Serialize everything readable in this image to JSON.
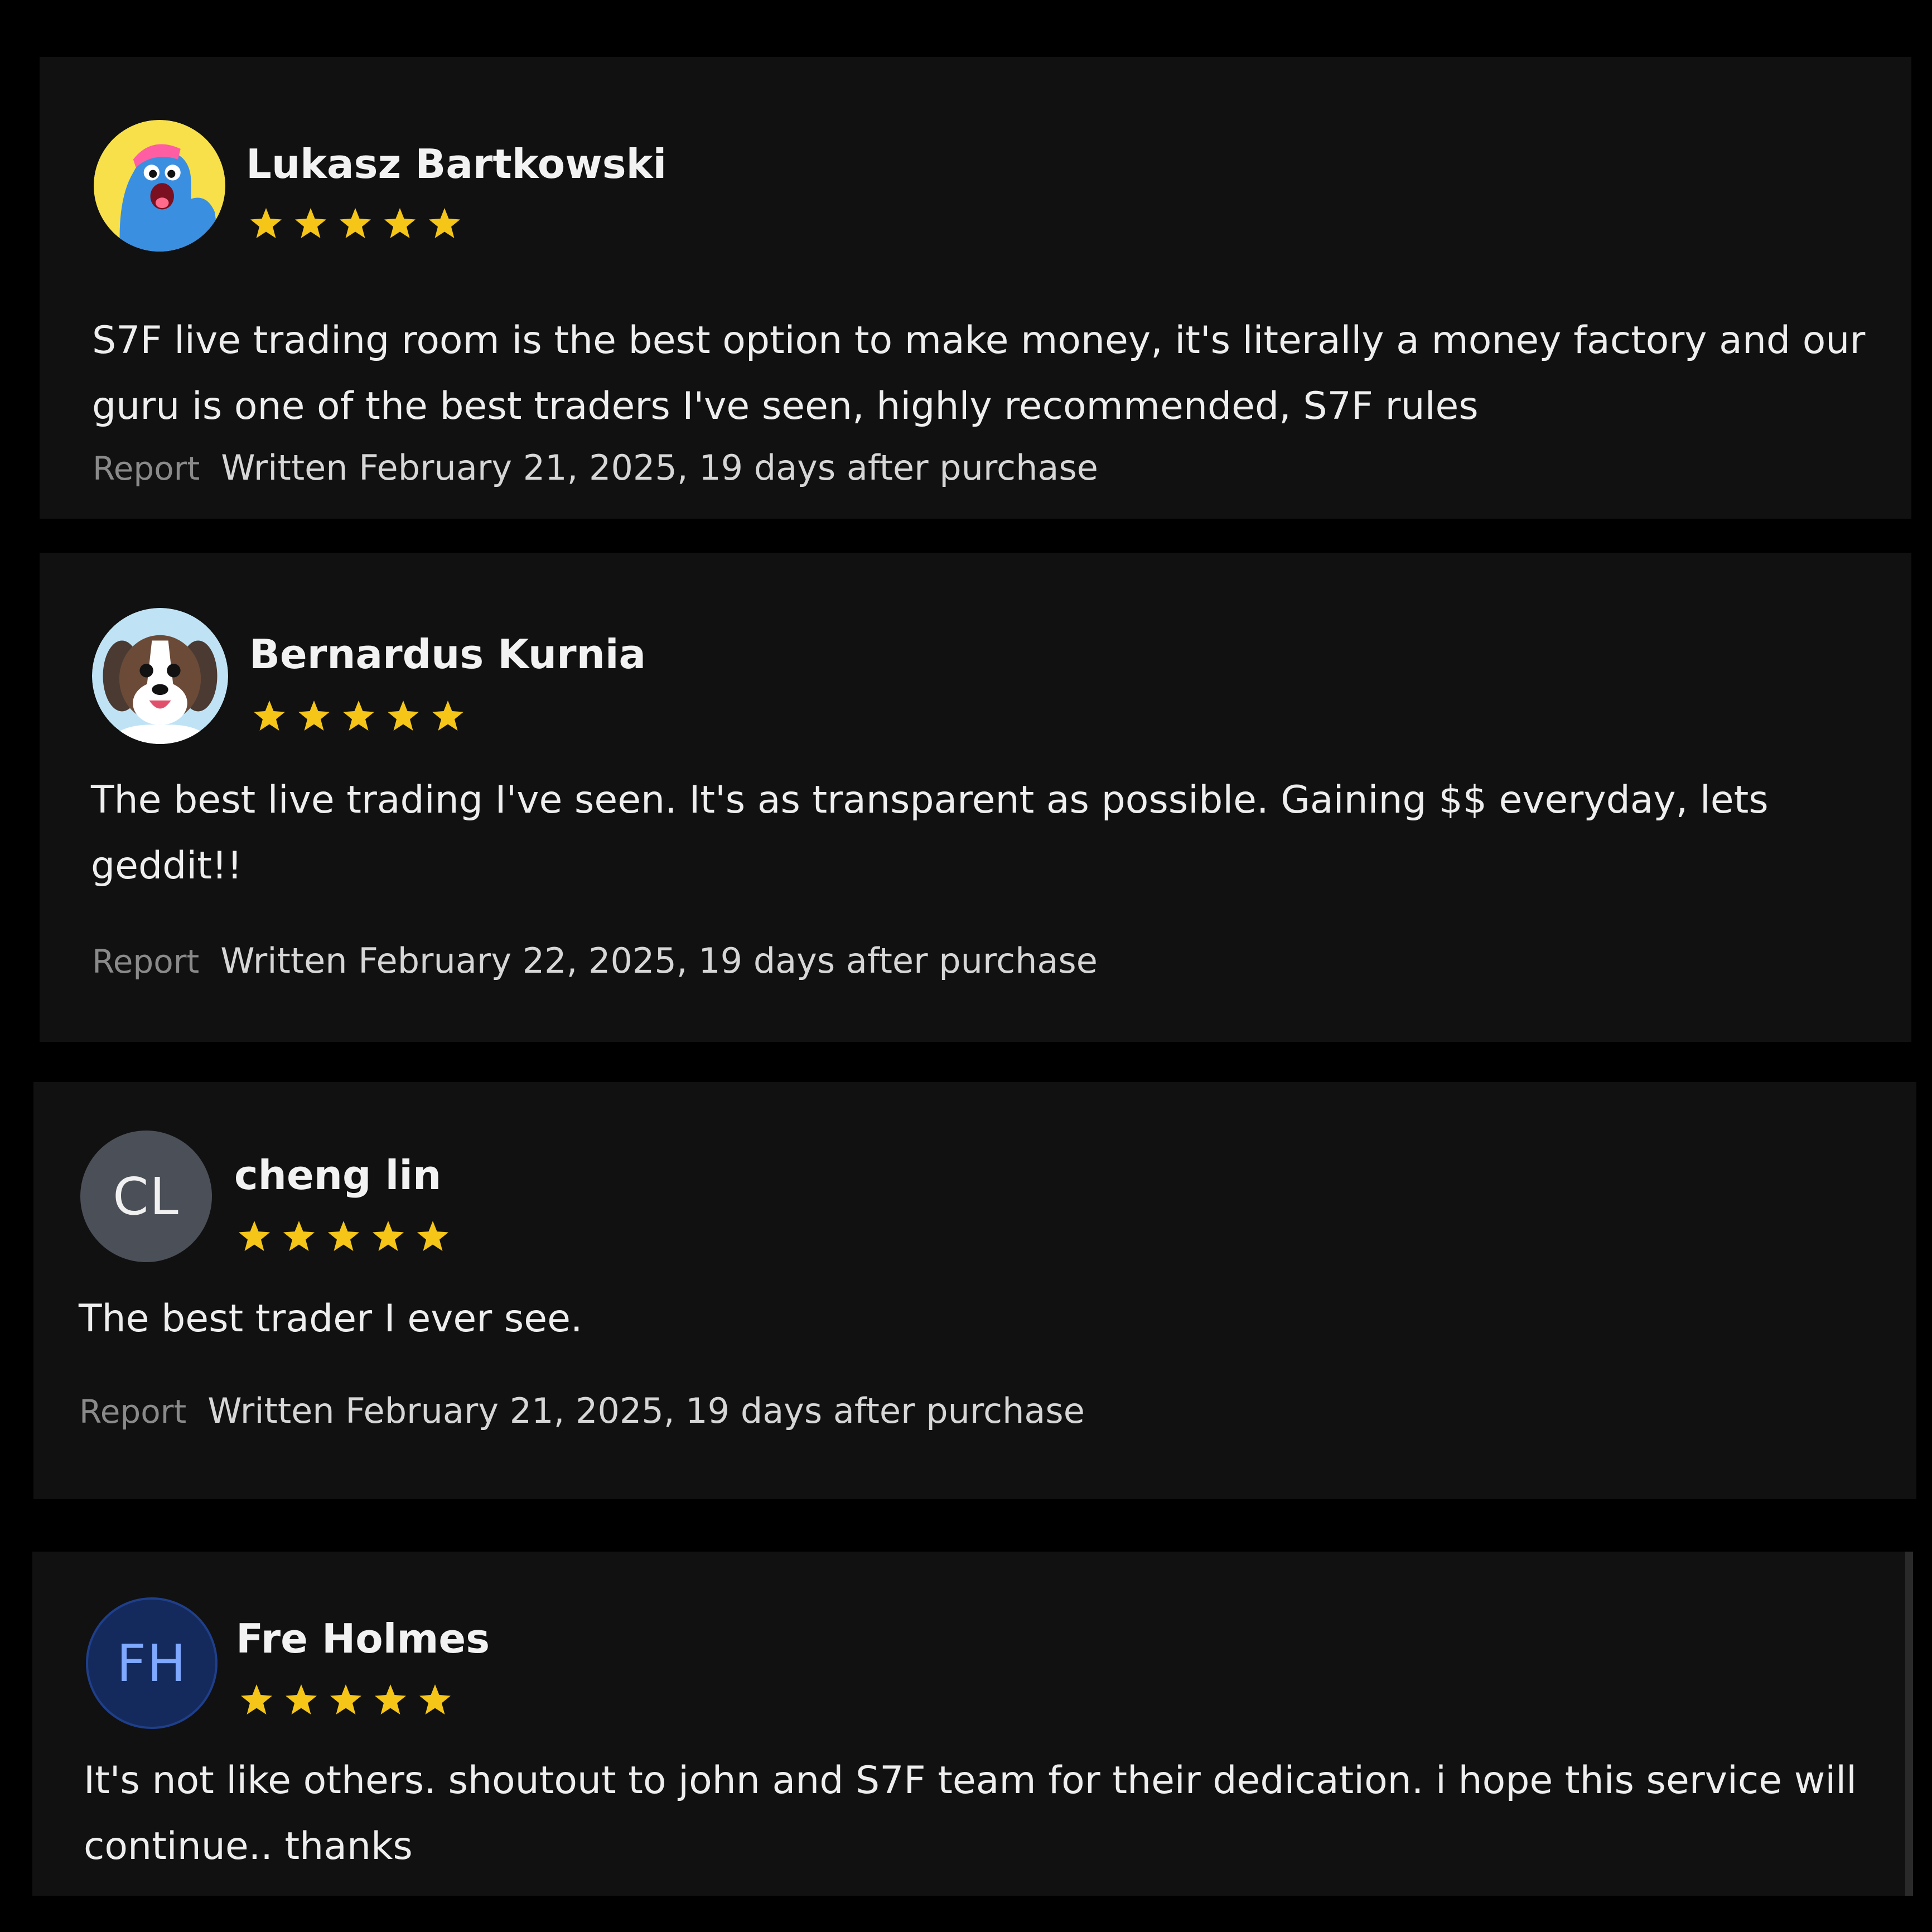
{
  "star_color": "#f5c518",
  "reviews": [
    {
      "name": "Lukasz Bartkowski",
      "avatar": "cartoon-monster-avatar",
      "rating": 5,
      "text": "S7F live trading room is the best option to make money, it's literally a money factory and our guru is one of the best traders I've seen, highly recommended, S7F rules",
      "report_label": "Report",
      "written": "Written February 21, 2025, 19 days after purchase"
    },
    {
      "name": "Bernardus Kurnia",
      "avatar": "cartoon-dog-avatar",
      "rating": 5,
      "text": "The best live trading I've seen. It's as transparent as possible. Gaining $$ everyday, lets geddit!!",
      "report_label": "Report",
      "written": "Written February 22, 2025, 19 days after purchase"
    },
    {
      "name": "cheng lin",
      "initials": "CL",
      "avatar_bg": "#4b4f57",
      "avatar_fg": "#f0f0f0",
      "rating": 5,
      "text": "The best trader I ever see.",
      "report_label": "Report",
      "written": "Written February 21, 2025, 19 days after purchase"
    },
    {
      "name": "Fre Holmes",
      "initials": "FH",
      "avatar_bg": "#142a5c",
      "avatar_fg": "#7fa8ff",
      "rating": 5,
      "text": "It's not like others. shoutout to john and S7F team for their dedication. i hope this service will continue.. thanks"
    }
  ]
}
